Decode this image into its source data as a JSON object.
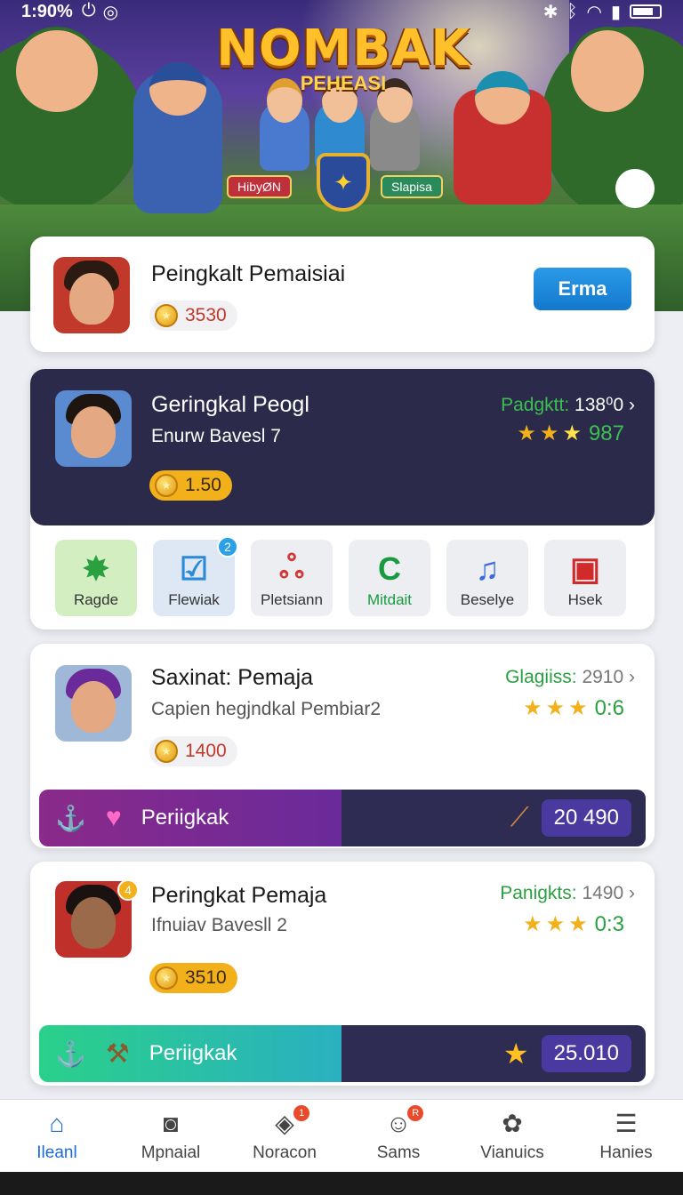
{
  "status_bar": {
    "time": "1:90%"
  },
  "banner": {
    "game_title": "NOMBAK",
    "game_subtitle": "PEHEASI",
    "left_tag": "HibyØN",
    "right_tag": "Slapisa"
  },
  "cards": [
    {
      "title": "Peingkalt Pemaisiai",
      "coins": "3530",
      "button": "Erma"
    },
    {
      "title": "Geringkal Peogl",
      "subtitle": "Enurw Bavesl 7",
      "coins": "1.50",
      "rank_label": "Padgktt:",
      "rank_value": "138⁰0",
      "score": "987",
      "tiles": [
        {
          "label": "Ragde",
          "icon": "gem-icon"
        },
        {
          "label": "Flewiak",
          "icon": "chart-icon",
          "badge": "2"
        },
        {
          "label": "Pletsiann",
          "icon": "knot-icon"
        },
        {
          "label": "Mitdait",
          "icon": "refresh-icon"
        },
        {
          "label": "Beselye",
          "icon": "music-icon"
        },
        {
          "label": "Hsek",
          "icon": "gift-icon"
        }
      ]
    },
    {
      "title": "Saxinat: Pemaja",
      "subtitle": "Capien hegjndkal Pembiar2",
      "coins": "1400",
      "rank_label": "Glagiiss:",
      "rank_value": "2910",
      "score": "0:6",
      "strip_label": "Periigkak",
      "strip_value": "20 490"
    },
    {
      "title": "Peringkat Pemaja",
      "subtitle": "Ifnuiav Bavesll 2",
      "coins": "3510",
      "rank_label": "Panigkts:",
      "rank_value": "1490",
      "score": "0:3",
      "avatar_badge": "4",
      "strip_label": "Periigkak",
      "strip_value": "25.010"
    }
  ],
  "bottom_nav": [
    {
      "label": "Ileanl",
      "icon": "home-icon",
      "active": true
    },
    {
      "label": "Mpnaial",
      "icon": "camera-icon"
    },
    {
      "label": "Noracon",
      "icon": "tag-icon",
      "badge": "1"
    },
    {
      "label": "Sams",
      "icon": "person-icon",
      "badge": "R"
    },
    {
      "label": "Vianuics",
      "icon": "puzzle-icon"
    },
    {
      "label": "Hanies",
      "icon": "menu-icon"
    }
  ],
  "colors": {
    "accent_blue": "#1a6adb",
    "rank_green": "#2aa040",
    "dark_card": "#2c2a4a",
    "star_gold": "#f2b01a"
  }
}
